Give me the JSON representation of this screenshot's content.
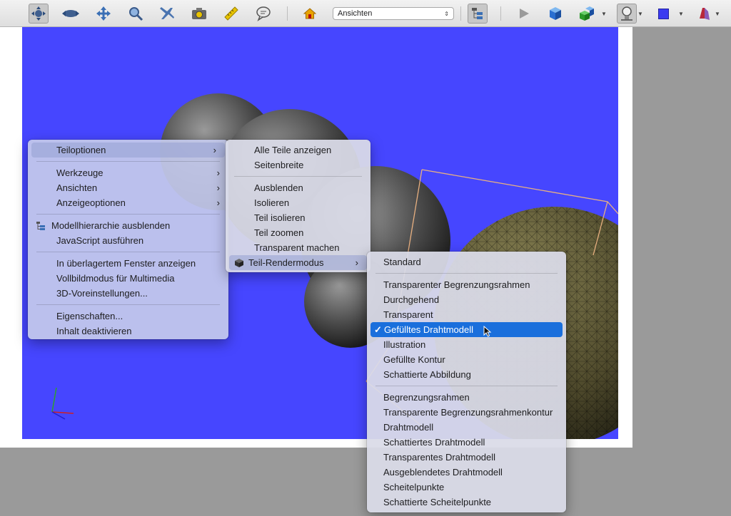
{
  "toolbar": {
    "icons": [
      "rotate-icon",
      "spin-icon",
      "pan-icon",
      "zoom-icon",
      "fly-icon",
      "camera-icon",
      "measure-icon",
      "comment-icon",
      "home-icon",
      "play-icon",
      "cube-icon",
      "parts-icon",
      "lighting-icon",
      "background-color-icon",
      "cross-section-icon"
    ],
    "views_select": "Ansichten",
    "background_color": "#3a3af0"
  },
  "viewport": {
    "background": "#4646ff"
  },
  "context_menu": {
    "items": [
      {
        "label": "Teiloptionen",
        "submenu": true
      },
      {
        "label": "Werkzeuge",
        "submenu": true
      },
      {
        "label": "Ansichten",
        "submenu": true
      },
      {
        "label": "Anzeigeoptionen",
        "submenu": true
      },
      {
        "label": "Modellhierarchie ausblenden"
      },
      {
        "label": "JavaScript ausführen"
      },
      {
        "label": "In überlagertem Fenster anzeigen"
      },
      {
        "label": "Vollbildmodus für Multimedia"
      },
      {
        "label": "3D-Voreinstellungen..."
      },
      {
        "label": "Eigenschaften..."
      },
      {
        "label": "Inhalt deaktivieren"
      }
    ]
  },
  "part_menu": {
    "items": [
      {
        "label": "Alle Teile anzeigen"
      },
      {
        "label": "Seitenbreite"
      },
      {
        "label": "Ausblenden"
      },
      {
        "label": "Isolieren"
      },
      {
        "label": "Teil isolieren"
      },
      {
        "label": "Teil zoomen"
      },
      {
        "label": "Transparent machen"
      },
      {
        "label": "Teil-Rendermodus",
        "submenu": true
      }
    ]
  },
  "render_menu": {
    "items": [
      {
        "label": "Standard"
      },
      {
        "label": "Transparenter Begrenzungsrahmen"
      },
      {
        "label": "Durchgehend"
      },
      {
        "label": "Transparent"
      },
      {
        "label": "Gefülltes Drahtmodell",
        "checked": true
      },
      {
        "label": "Illustration"
      },
      {
        "label": "Gefüllte Kontur"
      },
      {
        "label": "Schattierte Abbildung"
      },
      {
        "label": "Begrenzungsrahmen"
      },
      {
        "label": "Transparente Begrenzungsrahmenkontur"
      },
      {
        "label": "Drahtmodell"
      },
      {
        "label": "Schattiertes Drahtmodell"
      },
      {
        "label": "Transparentes Drahtmodell"
      },
      {
        "label": "Ausgeblendetes Drahtmodell"
      },
      {
        "label": "Scheitelpunkte"
      },
      {
        "label": "Schattierte Scheitelpunkte"
      }
    ],
    "checkmark": "✓"
  }
}
